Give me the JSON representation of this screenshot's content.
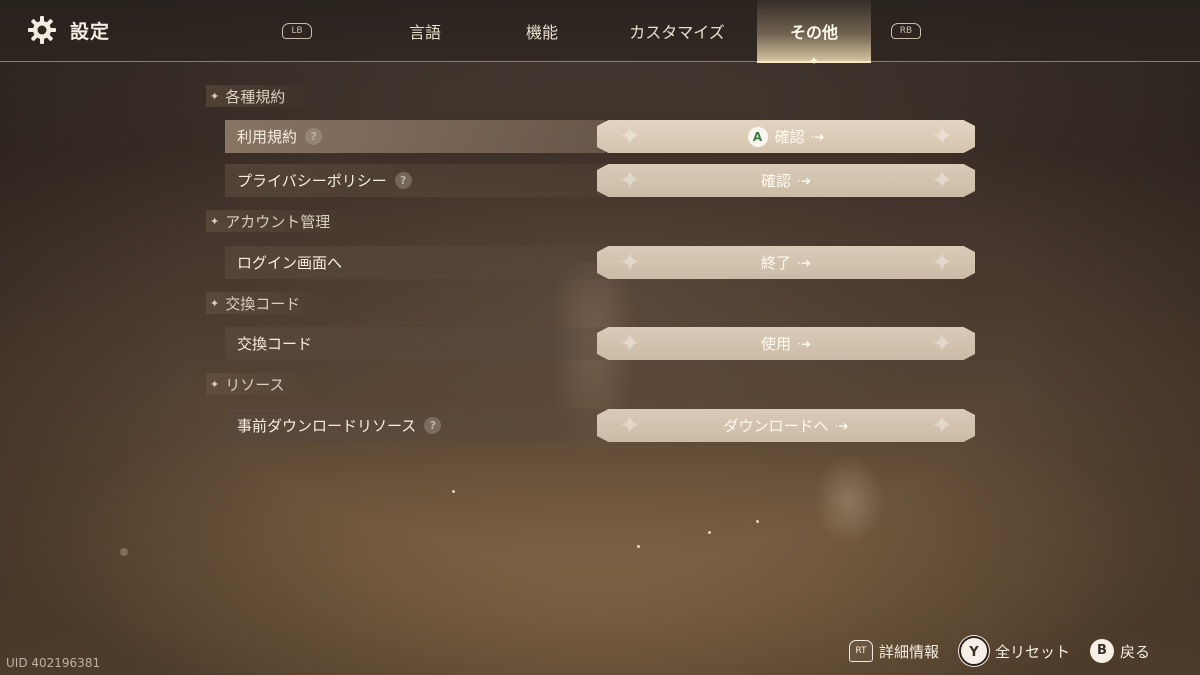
{
  "header": {
    "title": "設定",
    "lb_label": "LB",
    "rb_label": "RB",
    "tabs": [
      {
        "label": "言語",
        "active": false
      },
      {
        "label": "機能",
        "active": false
      },
      {
        "label": "カスタマイズ",
        "active": false
      },
      {
        "label": "その他",
        "active": true
      }
    ]
  },
  "sections": [
    {
      "title": "各種規約",
      "rows": [
        {
          "label": "利用規約",
          "help": "?",
          "action": "確認",
          "button_hint": "A",
          "highlighted": true
        },
        {
          "label": "プライバシーポリシー",
          "help": "?",
          "action": "確認",
          "highlighted": false
        }
      ]
    },
    {
      "title": "アカウント管理",
      "rows": [
        {
          "label": "ログイン画面へ",
          "action": "終了"
        }
      ]
    },
    {
      "title": "交換コード",
      "rows": [
        {
          "label": "交換コード",
          "action": "使用"
        }
      ]
    },
    {
      "title": "リソース",
      "rows": [
        {
          "label": "事前ダウンロードリソース",
          "help": "?",
          "action": "ダウンロードへ"
        }
      ]
    }
  ],
  "footer": {
    "uid": "UID 402196381",
    "details": {
      "button": "RT",
      "label": "詳細情報"
    },
    "reset": {
      "button": "Y",
      "label": "全リセット"
    },
    "back": {
      "button": "B",
      "label": "戻る"
    }
  },
  "colors": {
    "accent": "#f8e8c8",
    "action_button": "#d9cbb8",
    "a_button_text": "#3e7a44"
  }
}
